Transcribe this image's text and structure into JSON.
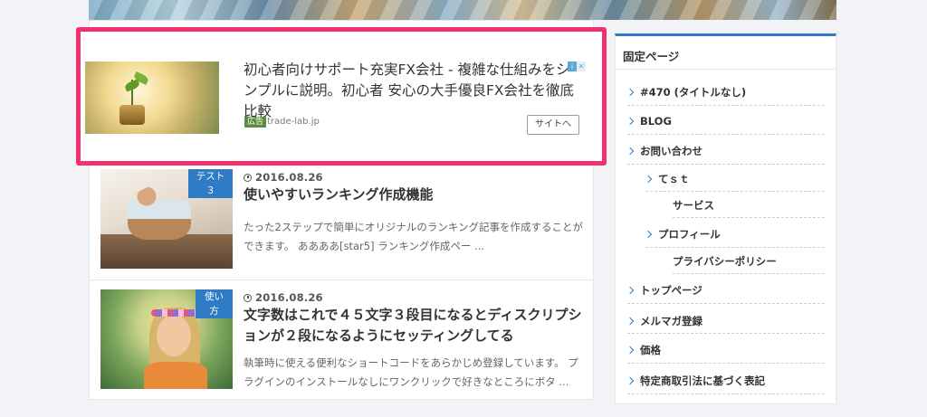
{
  "ad": {
    "title": "初心者向けサポート充実FX会社 - 複雑な仕組みをシンプルに説明。初心者 安心の大手優良FX会社を徹底比較",
    "badge": "広告",
    "domain": "trade-lab.jp",
    "button": "サイトへ",
    "info_icon": "i",
    "close_icon": "✕"
  },
  "posts": [
    {
      "category": "テスト３",
      "date": "2016.08.26",
      "title": "使いやすいランキング作成機能",
      "excerpt": "たった2ステップで簡単にオリジナルのランキング記事を作成することができます。 ああああ[star5] ランキング作成ペー ..."
    },
    {
      "category": "使い方",
      "date": "2016.08.26",
      "title": "文字数はこれで４５文字３段目になるとディスクリプションが２段になるようにセッティングしてる",
      "excerpt": "執筆時に使える便利なショートコードをあらかじめ登録しています。 プラグインのインストールなしにワンクリックで好きなところにボタ ..."
    }
  ],
  "sidebar": {
    "title": "固定ページ",
    "items": [
      "#470 (タイトルなし)",
      "BLOG",
      "お問い合わせ",
      "てｓｔ",
      "サービス",
      "プロフィール",
      "プライバシーポリシー",
      "トップページ",
      "メルマガ登録",
      "価格",
      "特定商取引法に基づく表記"
    ]
  },
  "colors": {
    "accent": "#2f7bc6",
    "highlight": "#f0306f"
  }
}
